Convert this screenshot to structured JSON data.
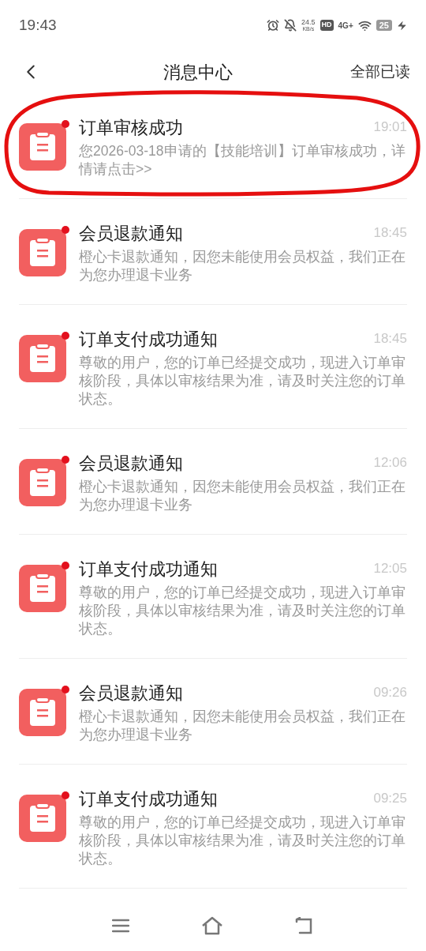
{
  "status_bar": {
    "time": "19:43",
    "net_speed": "24.5",
    "net_unit": "KB/s",
    "hd": "HD",
    "network": "4G+",
    "battery": "25"
  },
  "header": {
    "title": "消息中心",
    "action": "全部已读"
  },
  "messages": [
    {
      "title": "订单审核成功",
      "time": "19:01",
      "body": "您2026-03-18申请的【技能培训】订单审核成功，详情请点击>>",
      "unread": true
    },
    {
      "title": "会员退款通知",
      "time": "18:45",
      "body": "橙心卡退款通知，因您未能使用会员权益，我们正在为您办理退卡业务",
      "unread": true
    },
    {
      "title": "订单支付成功通知",
      "time": "18:45",
      "body": "尊敬的用户，您的订单已经提交成功，现进入订单审核阶段，具体以审核结果为准，请及时关注您的订单状态。",
      "unread": true
    },
    {
      "title": "会员退款通知",
      "time": "12:06",
      "body": "橙心卡退款通知，因您未能使用会员权益，我们正在为您办理退卡业务",
      "unread": true
    },
    {
      "title": "订单支付成功通知",
      "time": "12:05",
      "body": "尊敬的用户，您的订单已经提交成功，现进入订单审核阶段，具体以审核结果为准，请及时关注您的订单状态。",
      "unread": true
    },
    {
      "title": "会员退款通知",
      "time": "09:26",
      "body": "橙心卡退款通知，因您未能使用会员权益，我们正在为您办理退卡业务",
      "unread": true
    },
    {
      "title": "订单支付成功通知",
      "time": "09:25",
      "body": "尊敬的用户，您的订单已经提交成功，现进入订单审核阶段，具体以审核结果为准，请及时关注您的订单状态。",
      "unread": true
    }
  ]
}
